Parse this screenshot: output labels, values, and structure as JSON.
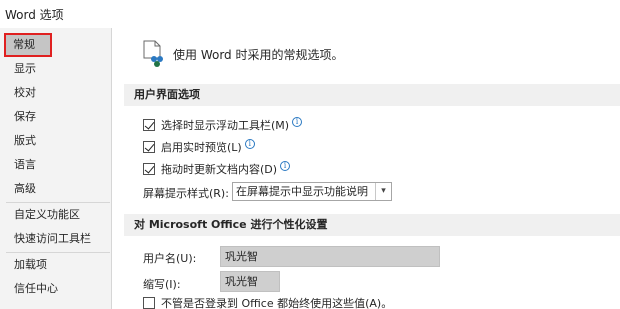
{
  "window": {
    "title": "Word 选项"
  },
  "sidebar": {
    "items": [
      {
        "label": "常规"
      },
      {
        "label": "显示"
      },
      {
        "label": "校对"
      },
      {
        "label": "保存"
      },
      {
        "label": "版式"
      },
      {
        "label": "语言"
      },
      {
        "label": "高级"
      },
      {
        "label": "自定义功能区"
      },
      {
        "label": "快速访问工具栏"
      },
      {
        "label": "加载项"
      },
      {
        "label": "信任中心"
      }
    ]
  },
  "main": {
    "intro": "使用 Word 时采用的常规选项。",
    "ui_section": {
      "title": "用户界面选项",
      "options": [
        {
          "label": "选择时显示浮动工具栏(M)",
          "checked": true
        },
        {
          "label": "启用实时预览(L)",
          "checked": true
        },
        {
          "label": "拖动时更新文档内容(D)",
          "checked": true
        }
      ],
      "screentip_label": "屏幕提示样式(R):",
      "screentip_value": "在屏幕提示中显示功能说明"
    },
    "personalize_section": {
      "title": "对 Microsoft Office 进行个性化设置",
      "username_label": "用户名(U):",
      "username_value": "巩光智",
      "initials_label": "缩写(I):",
      "initials_value": "巩光智",
      "always_use_label": "不管是否登录到 Office 都始终使用这些值(A)。",
      "always_use_checked": false
    }
  },
  "icons": {
    "info": "info-icon",
    "dropdown": "chevron-down-icon",
    "general_options": "general-options-icon"
  },
  "colors": {
    "selection_highlight": "#e02020",
    "info_icon": "#2b79c2"
  }
}
